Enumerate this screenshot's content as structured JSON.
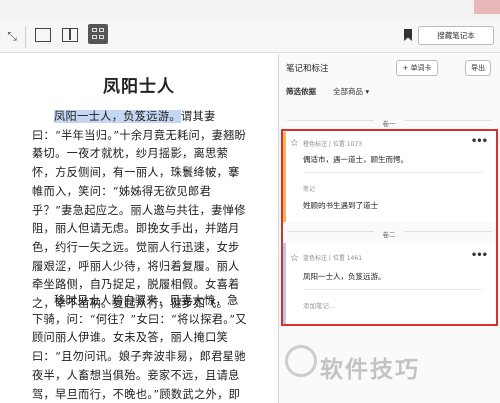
{
  "toolbar": {
    "expand_icon": "expand-icon",
    "layout_icons": [
      "single-page-layout-icon",
      "two-page-layout-icon",
      "grid-layout-icon"
    ],
    "bookmark_icon": "bookmark-icon",
    "notebook_button": "搜藏笔记本"
  },
  "reader": {
    "title": "凤阳士人",
    "p1_highlight": "凤阳一士人，负笈远游。",
    "p1_rest": "谓其妻曰：“半年当归。”十余月竟无耗问，妻翘盼綦切。一夜才就枕，纱月摇影，离思萦怀，方反侧间，有一丽人，珠鬟绛帔，搴帷而入，笑问：“姊姊得无欲见郎君乎？”妻急起应之。丽人邀与共往，妻惮修阻，丽人但请无虑。即挽女手出，并踏月色，约行一矢之远。觉丽人行迅速，女步履艰涩，呼丽人少待，将归着复履。丽人牵坐路侧，自乃捉足，脱履相假。女喜着之，幸不凿枘。复起从行，健步如飞。",
    "p2": "移时见士人跨白骡来，见妻大惊，急下骑，问：“何往？”女曰：“将以探君。”又顾问丽人伊谁。女未及答，丽人掩口笑曰：“且勿问讯。娘子奔波非易，郎君星驰夜半，人畜想当俱殆。妾家不远，且请息驾，早旦而行，不晚也。”顾数武之外，即有村落，遂同行入一庭院，丽人促睡婢"
  },
  "panel": {
    "title": "笔记和标注",
    "add_card_button": "+ 单词卡",
    "export_button": "导出",
    "filter_label": "筛选依据",
    "filter_value": "全部商品",
    "filter_arrow": "▾",
    "chapters": [
      {
        "heading": "卷一",
        "card": {
          "meta": "橙色标注 | 位置 1073",
          "quote": "偶适市，遇一道士，顾生而愕。",
          "note_label": "笔记",
          "note_text": "姓顾的书生遇到了道士",
          "color": "#f1b461"
        }
      },
      {
        "heading": "卷二",
        "card": {
          "meta": "蓝色标注 | 位置 1461",
          "quote": "凤阳一士人，负笈远游。",
          "add_note": "添加笔记...",
          "color": "#b8c9ec"
        }
      }
    ]
  },
  "watermark": "软件技巧",
  "colors": {
    "highlight_blue": "#c5d6f2",
    "annotation_box": "#d9302c"
  }
}
